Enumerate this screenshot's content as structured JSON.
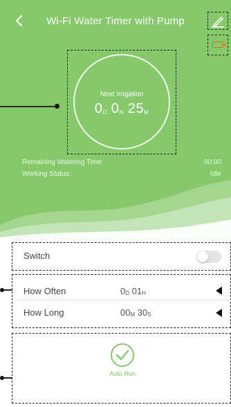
{
  "header": {
    "title": "Wi-Fi Water Timer with Pump",
    "back_icon": "chevron-left-icon",
    "edit_icon": "pencil-icon"
  },
  "status": {
    "battery_icon": "battery-low-icon",
    "next_label": "Next Irrigation",
    "next_time": {
      "d_value": "0",
      "d_unit": "D",
      "h_value": "0",
      "h_unit": "H",
      "m_value": "25",
      "m_unit": "M"
    },
    "remaining_label": "Remaining Watering Time:",
    "remaining_value": "00:00",
    "working_label": "Working Status:",
    "working_value": "Idle"
  },
  "controls": {
    "switch_label": "Switch",
    "switch_on": false,
    "how_often_label": "How Often",
    "how_often_value": {
      "d_value": "0",
      "d_unit": "D",
      "h_value": "01",
      "h_unit": "H"
    },
    "how_long_label": "How Long",
    "how_long_value": {
      "m_value": "00",
      "m_unit": "M",
      "s_value": "30",
      "s_unit": "S"
    },
    "auto_run_label": "Auto Run",
    "auto_run_icon": "check-circle-icon"
  },
  "colors": {
    "brand_green": "#86c96a",
    "battery_warning": "#e07020",
    "annotation": "#1f1f1f"
  }
}
